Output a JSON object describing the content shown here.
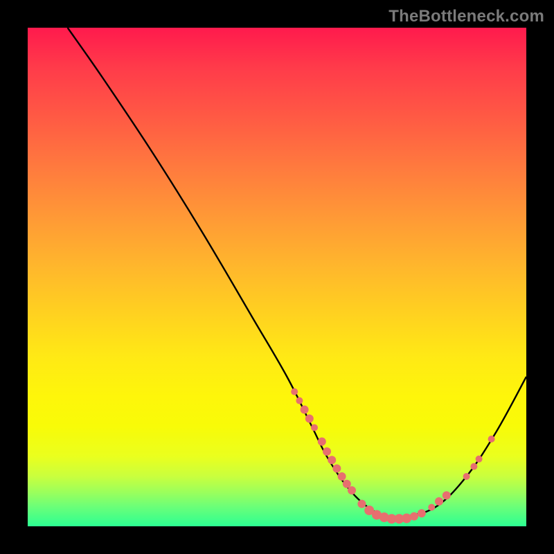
{
  "watermark": "TheBottleneck.com",
  "colors": {
    "frame": "#000000",
    "curve": "#000000",
    "marker": "#e76f6f",
    "gradient_top": "#ff1a4d",
    "gradient_bottom": "#2cff92"
  },
  "chart_data": {
    "type": "line",
    "title": "",
    "xlabel": "",
    "ylabel": "",
    "xlim": [
      0,
      100
    ],
    "ylim": [
      0,
      100
    ],
    "series": [
      {
        "name": "curve",
        "x": [
          8,
          15,
          25,
          35,
          45,
          52,
          57,
          60,
          64,
          68,
          72,
          76,
          82,
          88,
          94,
          100
        ],
        "y": [
          100,
          90,
          75,
          59,
          42,
          30,
          20,
          14,
          8,
          4,
          2,
          2,
          4,
          10,
          19,
          30
        ]
      }
    ],
    "markers": [
      {
        "x": 53.5,
        "y": 27.0,
        "r": 5
      },
      {
        "x": 54.5,
        "y": 25.2,
        "r": 5
      },
      {
        "x": 55.5,
        "y": 23.4,
        "r": 6
      },
      {
        "x": 56.5,
        "y": 21.6,
        "r": 6
      },
      {
        "x": 57.5,
        "y": 19.8,
        "r": 5
      },
      {
        "x": 59.0,
        "y": 17.0,
        "r": 6
      },
      {
        "x": 60.0,
        "y": 15.0,
        "r": 6
      },
      {
        "x": 61.0,
        "y": 13.3,
        "r": 6
      },
      {
        "x": 62.0,
        "y": 11.6,
        "r": 6
      },
      {
        "x": 63.0,
        "y": 10.0,
        "r": 6
      },
      {
        "x": 64.0,
        "y": 8.5,
        "r": 6
      },
      {
        "x": 65.0,
        "y": 7.2,
        "r": 6
      },
      {
        "x": 67.0,
        "y": 4.5,
        "r": 6
      },
      {
        "x": 68.5,
        "y": 3.2,
        "r": 7
      },
      {
        "x": 70.0,
        "y": 2.3,
        "r": 7
      },
      {
        "x": 71.5,
        "y": 1.8,
        "r": 7
      },
      {
        "x": 73.0,
        "y": 1.5,
        "r": 7
      },
      {
        "x": 74.5,
        "y": 1.5,
        "r": 7
      },
      {
        "x": 76.0,
        "y": 1.6,
        "r": 7
      },
      {
        "x": 77.5,
        "y": 2.0,
        "r": 6
      },
      {
        "x": 79.0,
        "y": 2.6,
        "r": 6
      },
      {
        "x": 81.0,
        "y": 3.8,
        "r": 5
      },
      {
        "x": 82.5,
        "y": 5.0,
        "r": 6
      },
      {
        "x": 84.0,
        "y": 6.2,
        "r": 6
      },
      {
        "x": 88.0,
        "y": 10.0,
        "r": 5
      },
      {
        "x": 89.5,
        "y": 12.0,
        "r": 5
      },
      {
        "x": 90.5,
        "y": 13.5,
        "r": 5
      },
      {
        "x": 93.0,
        "y": 17.5,
        "r": 5
      }
    ]
  }
}
